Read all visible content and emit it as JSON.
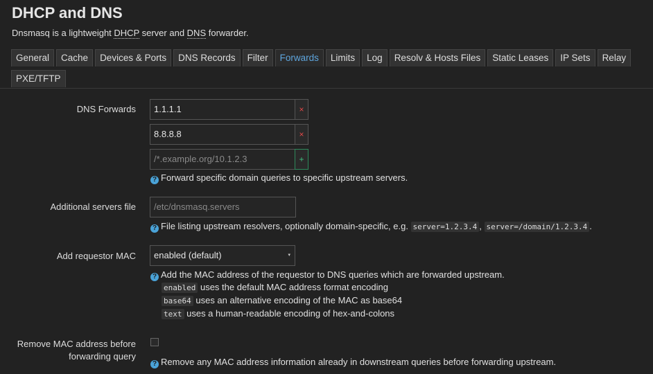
{
  "page": {
    "title": "DHCP and DNS",
    "description_prefix": "Dnsmasq is a lightweight ",
    "description_abbr1": "DHCP",
    "description_mid": " server and ",
    "description_abbr2": "DNS",
    "description_suffix": " forwarder."
  },
  "tabs": [
    {
      "label": "General"
    },
    {
      "label": "Cache"
    },
    {
      "label": "Devices & Ports"
    },
    {
      "label": "DNS Records"
    },
    {
      "label": "Filter"
    },
    {
      "label": "Forwards",
      "active": true
    },
    {
      "label": "Limits"
    },
    {
      "label": "Log"
    },
    {
      "label": "Resolv & Hosts Files"
    },
    {
      "label": "Static Leases"
    },
    {
      "label": "IP Sets"
    },
    {
      "label": "Relay"
    },
    {
      "label": "PXE/TFTP"
    }
  ],
  "dns_forwards": {
    "label": "DNS Forwards",
    "entries": [
      "1.1.1.1",
      "8.8.8.8"
    ],
    "new_placeholder": "/*.example.org/10.1.2.3",
    "remove_symbol": "×",
    "add_symbol": "+",
    "help": "Forward specific domain queries to specific upstream servers."
  },
  "additional_servers": {
    "label": "Additional servers file",
    "placeholder": "/etc/dnsmasq.servers",
    "help_prefix": "File listing upstream resolvers, optionally domain-specific, e.g. ",
    "example1": "server=1.2.3.4",
    "sep": ", ",
    "example2": "server=/domain/1.2.3.4",
    "help_suffix": "."
  },
  "requestor_mac": {
    "label": "Add requestor MAC",
    "selected": "enabled (default)",
    "help": "Add the MAC address of the requestor to DNS queries which are forwarded upstream.",
    "options": [
      {
        "code": "enabled",
        "text": " uses the default MAC address format encoding"
      },
      {
        "code": "base64",
        "text": " uses an alternative encoding of the MAC as base64"
      },
      {
        "code": "text",
        "text": " uses a human-readable encoding of hex-and-colons"
      }
    ]
  },
  "remove_mac": {
    "label_line1": "Remove MAC address before",
    "label_line2": "forwarding query",
    "checked": false,
    "help": "Remove any MAC address information already in downstream queries before forwarding upstream."
  },
  "icons": {
    "help": "?",
    "caret": "▾"
  },
  "colors": {
    "accent": "#5ea5dd",
    "remove": "#e04848",
    "add": "#3fbf7f",
    "help_icon": "#4aa3d8"
  }
}
